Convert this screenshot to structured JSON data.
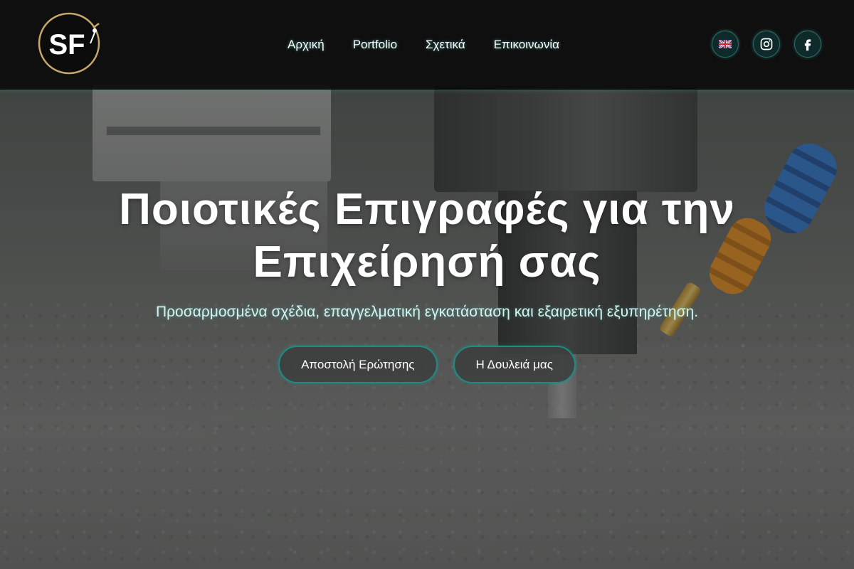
{
  "header": {
    "logo": {
      "text": "SF",
      "icon": "sf-logo-icon",
      "ring_color": "#c8a86a"
    },
    "nav": [
      {
        "label": "Αρχική"
      },
      {
        "label": "Portfolio"
      },
      {
        "label": "Σχετικά"
      },
      {
        "label": "Επικοινωνία"
      }
    ],
    "social": [
      {
        "icon": "uk-flag-icon"
      },
      {
        "icon": "instagram-icon"
      },
      {
        "icon": "facebook-icon"
      }
    ]
  },
  "hero": {
    "title": "Ποιοτικές Επιγραφές για την Επιχείρησή σας",
    "subtitle": "Προσαρμοσμένα σχέδια, επαγγελματική εγκατάσταση και εξαιρετική εξυπηρέτηση.",
    "buttons": [
      {
        "label": "Αποστολή Ερώτησης"
      },
      {
        "label": "Η Δουλειά μας"
      }
    ]
  },
  "colors": {
    "accent": "#1f8b84",
    "header_bg": "#0a0a0a",
    "button_bg": "#3e3f3f"
  }
}
